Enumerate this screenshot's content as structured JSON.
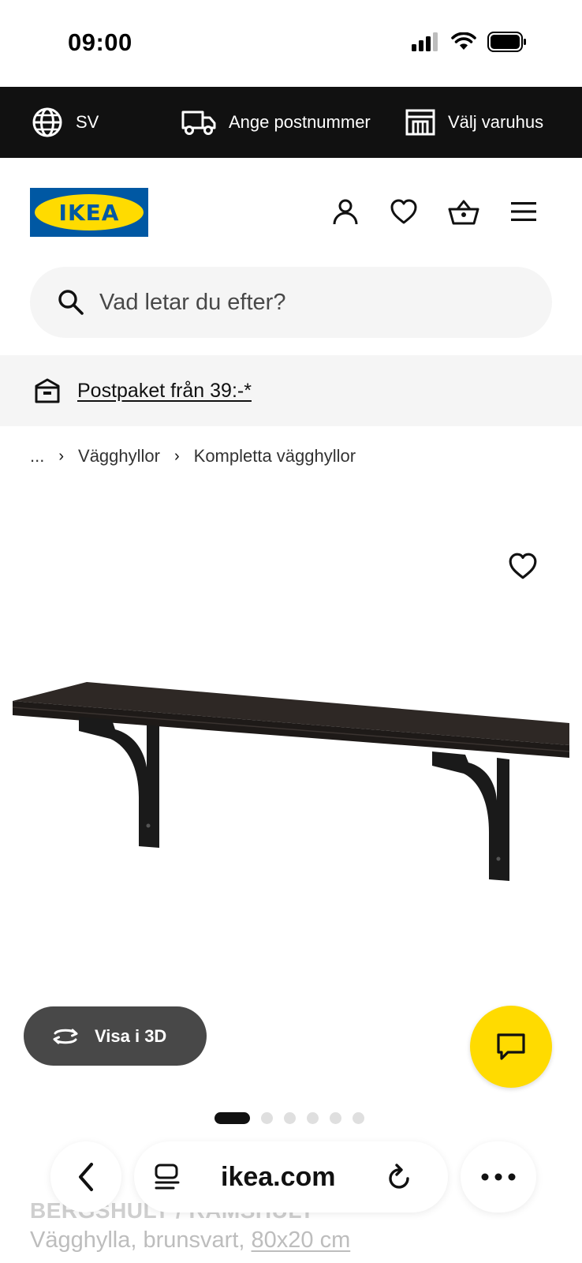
{
  "status_bar": {
    "time": "09:00"
  },
  "top_bar": {
    "language": "SV",
    "postcode_label": "Ange postnummer",
    "store_label": "Välj varuhus"
  },
  "header": {
    "logo_text": "IKEA"
  },
  "search": {
    "placeholder": "Vad letar du efter?"
  },
  "promo": {
    "text": "Postpaket från 39:-*"
  },
  "breadcrumb": {
    "items": [
      "...",
      "Vägghyllor",
      "Kompletta vägghyllor"
    ]
  },
  "gallery": {
    "view3d_label": "Visa i 3D",
    "image_count": 6,
    "active_index": 0
  },
  "product": {
    "name": "BERGSHULT / RAMSHULT",
    "description": "Vägghylla, brunsvart,",
    "size": "80x20 cm"
  },
  "browser": {
    "url": "ikea.com"
  },
  "colors": {
    "brand_blue": "#0058a3",
    "brand_yellow": "#ffdb00",
    "top_bar": "#111111"
  }
}
